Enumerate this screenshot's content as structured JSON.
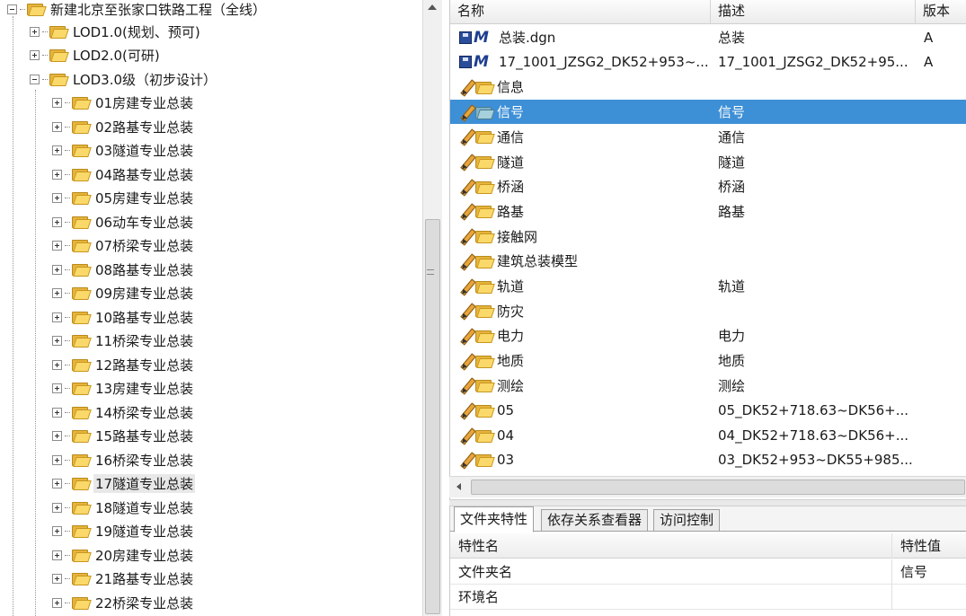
{
  "tree": {
    "root": "新建北京至张家口铁路工程（全线）",
    "lod_nodes": [
      "LOD1.0(规划、预可)",
      "LOD2.0(可研)",
      "LOD3.0级（初步设计）"
    ],
    "children": [
      "01房建专业总装",
      "02路基专业总装",
      "03隧道专业总装",
      "04路基专业总装",
      "05房建专业总装",
      "06动车专业总装",
      "07桥梁专业总装",
      "08路基专业总装",
      "09房建专业总装",
      "10路基专业总装",
      "11桥梁专业总装",
      "12路基专业总装",
      "13房建专业总装",
      "14桥梁专业总装",
      "15路基专业总装",
      "16桥梁专业总装",
      "17隧道专业总装",
      "18隧道专业总装",
      "19隧道专业总装",
      "20房建专业总装",
      "21路基专业总装",
      "22桥梁专业总装"
    ],
    "hovered_index": 16
  },
  "list": {
    "columns": {
      "name": "名称",
      "description": "描述",
      "version": "版本"
    },
    "rows": [
      {
        "kind": "file",
        "icon": "microstation-file-icon",
        "name": "总装.dgn",
        "description": "总装",
        "version": "A"
      },
      {
        "kind": "file",
        "icon": "microstation-reference-file-icon",
        "name": "17_1001_JZSG2_DK52+953~...",
        "description": "17_1001_JZSG2_DK52+95...",
        "version": "A"
      },
      {
        "kind": "folder",
        "name": "信息",
        "description": "",
        "version": ""
      },
      {
        "kind": "folder",
        "name": "信号",
        "description": "信号",
        "version": "",
        "selected": true
      },
      {
        "kind": "folder",
        "name": "通信",
        "description": "通信",
        "version": ""
      },
      {
        "kind": "folder",
        "name": "隧道",
        "description": "隧道",
        "version": ""
      },
      {
        "kind": "folder",
        "name": "桥涵",
        "description": "桥涵",
        "version": ""
      },
      {
        "kind": "folder",
        "name": "路基",
        "description": "路基",
        "version": ""
      },
      {
        "kind": "folder",
        "name": "接触网",
        "description": "",
        "version": ""
      },
      {
        "kind": "folder",
        "name": "建筑总装模型",
        "description": "",
        "version": ""
      },
      {
        "kind": "folder",
        "name": "轨道",
        "description": "轨道",
        "version": ""
      },
      {
        "kind": "folder",
        "name": "防灾",
        "description": "",
        "version": ""
      },
      {
        "kind": "folder",
        "name": "电力",
        "description": "电力",
        "version": ""
      },
      {
        "kind": "folder",
        "name": "地质",
        "description": "地质",
        "version": ""
      },
      {
        "kind": "folder",
        "name": "测绘",
        "description": "测绘",
        "version": ""
      },
      {
        "kind": "folder",
        "name": "05",
        "description": "05_DK52+718.63~DK56+...",
        "version": ""
      },
      {
        "kind": "folder",
        "name": "04",
        "description": "04_DK52+718.63~DK56+...",
        "version": ""
      },
      {
        "kind": "folder",
        "name": "03",
        "description": "03_DK52+953~DK55+985...",
        "version": ""
      }
    ]
  },
  "props": {
    "tabs": [
      "文件夹特性",
      "依存关系查看器",
      "访问控制"
    ],
    "active_tab": 0,
    "header": {
      "name": "特性名",
      "value": "特性值"
    },
    "rows": [
      {
        "name": "文件夹名",
        "value": "信号"
      },
      {
        "name": "环境名",
        "value": ""
      }
    ]
  },
  "colors": {
    "selection": "#3d8fd6",
    "folder": "#fad96a"
  }
}
